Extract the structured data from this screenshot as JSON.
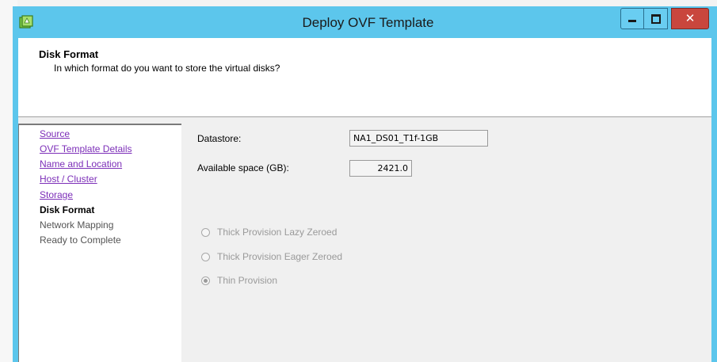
{
  "window": {
    "title": "Deploy OVF Template",
    "controls": {
      "minimize": "minimize-icon",
      "maximize": "maximize-icon",
      "close": "close-icon"
    }
  },
  "header": {
    "title": "Disk Format",
    "subtitle": "In which format do you want to store the virtual disks?"
  },
  "nav": {
    "items": [
      {
        "label": "Source",
        "state": "completed"
      },
      {
        "label": "OVF Template Details",
        "state": "completed"
      },
      {
        "label": "Name and Location",
        "state": "completed"
      },
      {
        "label": "Host / Cluster",
        "state": "completed"
      },
      {
        "label": "Storage",
        "state": "completed"
      },
      {
        "label": "Disk Format",
        "state": "current"
      },
      {
        "label": "Network Mapping",
        "state": "pending"
      },
      {
        "label": "Ready to Complete",
        "state": "pending"
      }
    ]
  },
  "form": {
    "datastore_label": "Datastore:",
    "datastore_value": "NA1_DS01_T1f-1GB",
    "available_label": "Available space (GB):",
    "available_value": "2421.0",
    "options": [
      {
        "label": "Thick Provision Lazy Zeroed",
        "checked": false,
        "enabled": false
      },
      {
        "label": "Thick Provision Eager Zeroed",
        "checked": false,
        "enabled": false
      },
      {
        "label": "Thin Provision",
        "checked": true,
        "enabled": false
      }
    ]
  },
  "colors": {
    "titlebar": "#5cc6ec",
    "close_button": "#c9463d",
    "link": "#7c2eb8"
  }
}
